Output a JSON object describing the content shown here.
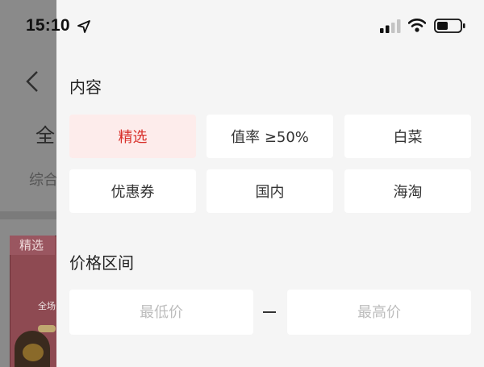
{
  "status_bar": {
    "time": "15:10"
  },
  "background_page": {
    "title_partial": "全",
    "tab_partial": "综合",
    "card_badge": "精选",
    "card_text_partial": "全场"
  },
  "filter": {
    "content_section": {
      "title": "内容",
      "options": [
        {
          "label": "精选",
          "selected": true
        },
        {
          "label": "值率 ≥50%",
          "selected": false
        },
        {
          "label": "白菜",
          "selected": false
        },
        {
          "label": "优惠券",
          "selected": false
        },
        {
          "label": "国内",
          "selected": false
        },
        {
          "label": "海淘",
          "selected": false
        }
      ]
    },
    "price_section": {
      "title": "价格区间",
      "min_placeholder": "最低价",
      "max_placeholder": "最高价",
      "min_value": "",
      "max_value": ""
    }
  },
  "colors": {
    "accent": "#d8302a",
    "selected_bg": "#fdeceb",
    "drawer_bg": "#f5f5f5",
    "chip_bg": "#ffffff"
  }
}
